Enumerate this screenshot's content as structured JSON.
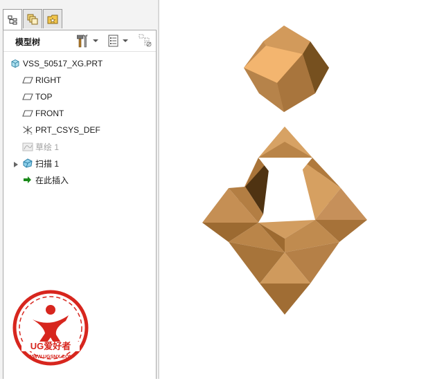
{
  "tabs": [
    {
      "name": "model-tree-tab",
      "icon": "model-tree-icon",
      "active": true
    },
    {
      "name": "layers-tab",
      "icon": "layers-icon",
      "active": false
    },
    {
      "name": "favorites-tab",
      "icon": "favorites-icon",
      "active": false
    }
  ],
  "tree": {
    "title": "模型树",
    "toolbar": {
      "settings_icon": "hammer-wrench-icon",
      "show_icon": "list-icon",
      "filter_icon": "filter-icon"
    },
    "root": {
      "label": "VSS_50517_XG.PRT",
      "icon": "part-icon"
    },
    "items": [
      {
        "label": "RIGHT",
        "icon": "datum-plane-icon",
        "disabled": false
      },
      {
        "label": "TOP",
        "icon": "datum-plane-icon",
        "disabled": false
      },
      {
        "label": "FRONT",
        "icon": "datum-plane-icon",
        "disabled": false
      },
      {
        "label": "PRT_CSYS_DEF",
        "icon": "coordinate-system-icon",
        "disabled": false
      },
      {
        "label": "草绘 1",
        "icon": "sketch-icon",
        "disabled": true
      },
      {
        "label": "扫描 1",
        "icon": "sweep-icon",
        "disabled": false,
        "expandable": true
      },
      {
        "label": "在此插入",
        "icon": "insert-here-arrow-icon",
        "disabled": false
      }
    ]
  },
  "watermark": {
    "brand": "UG爱好者",
    "url": "WWW.UGSNX.COM",
    "brand_color": "#d7261e"
  },
  "model": {
    "surface_color": "#c9955a",
    "light_color": "#f0b878",
    "shadow_color": "#7a5228"
  }
}
